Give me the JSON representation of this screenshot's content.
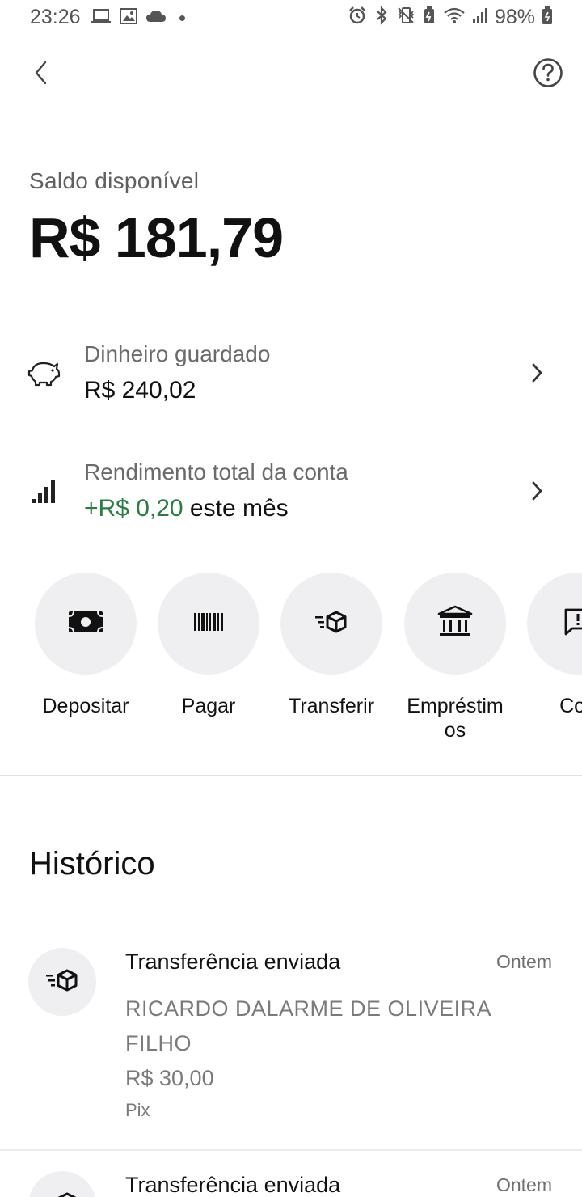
{
  "status_bar": {
    "time": "23:26",
    "battery": "98%",
    "icons": [
      "laptop-icon",
      "image-icon",
      "cloud-icon",
      "alarm-icon",
      "bluetooth-icon",
      "vibrate-icon",
      "battery-saver-icon",
      "wifi-icon",
      "signal-icon",
      "battery-icon"
    ]
  },
  "header": {
    "back_icon": "chevron-left-icon",
    "help_icon": "help-circle-icon"
  },
  "balance": {
    "label": "Saldo disponível",
    "value": "R$ 181,79"
  },
  "savings": {
    "icon": "piggy-bank-icon",
    "title": "Dinheiro guardado",
    "value": "R$ 240,02"
  },
  "yield": {
    "icon": "bar-chart-icon",
    "title": "Rendimento total da conta",
    "amount": "+R$ 0,20",
    "suffix": " este mês"
  },
  "actions": [
    {
      "label": "Depositar",
      "icon": "cash-icon"
    },
    {
      "label": "Pagar",
      "icon": "barcode-icon"
    },
    {
      "label": "Transferir",
      "icon": "transfer-icon"
    },
    {
      "label": "Empréstim\nos",
      "icon": "bank-icon"
    },
    {
      "label": "Cob",
      "icon": "message-alert-icon"
    }
  ],
  "history": {
    "title": "Histórico",
    "items": [
      {
        "type": "Transferência enviada",
        "date": "Ontem",
        "name": "RICARDO DALARME DE OLIVEIRA FILHO",
        "amount": "R$ 30,00",
        "method": "Pix"
      },
      {
        "type": "Transferência enviada",
        "date": "Ontem"
      }
    ]
  },
  "colors": {
    "accent_green": "#2c7c43",
    "action_bg": "#efeff2"
  }
}
